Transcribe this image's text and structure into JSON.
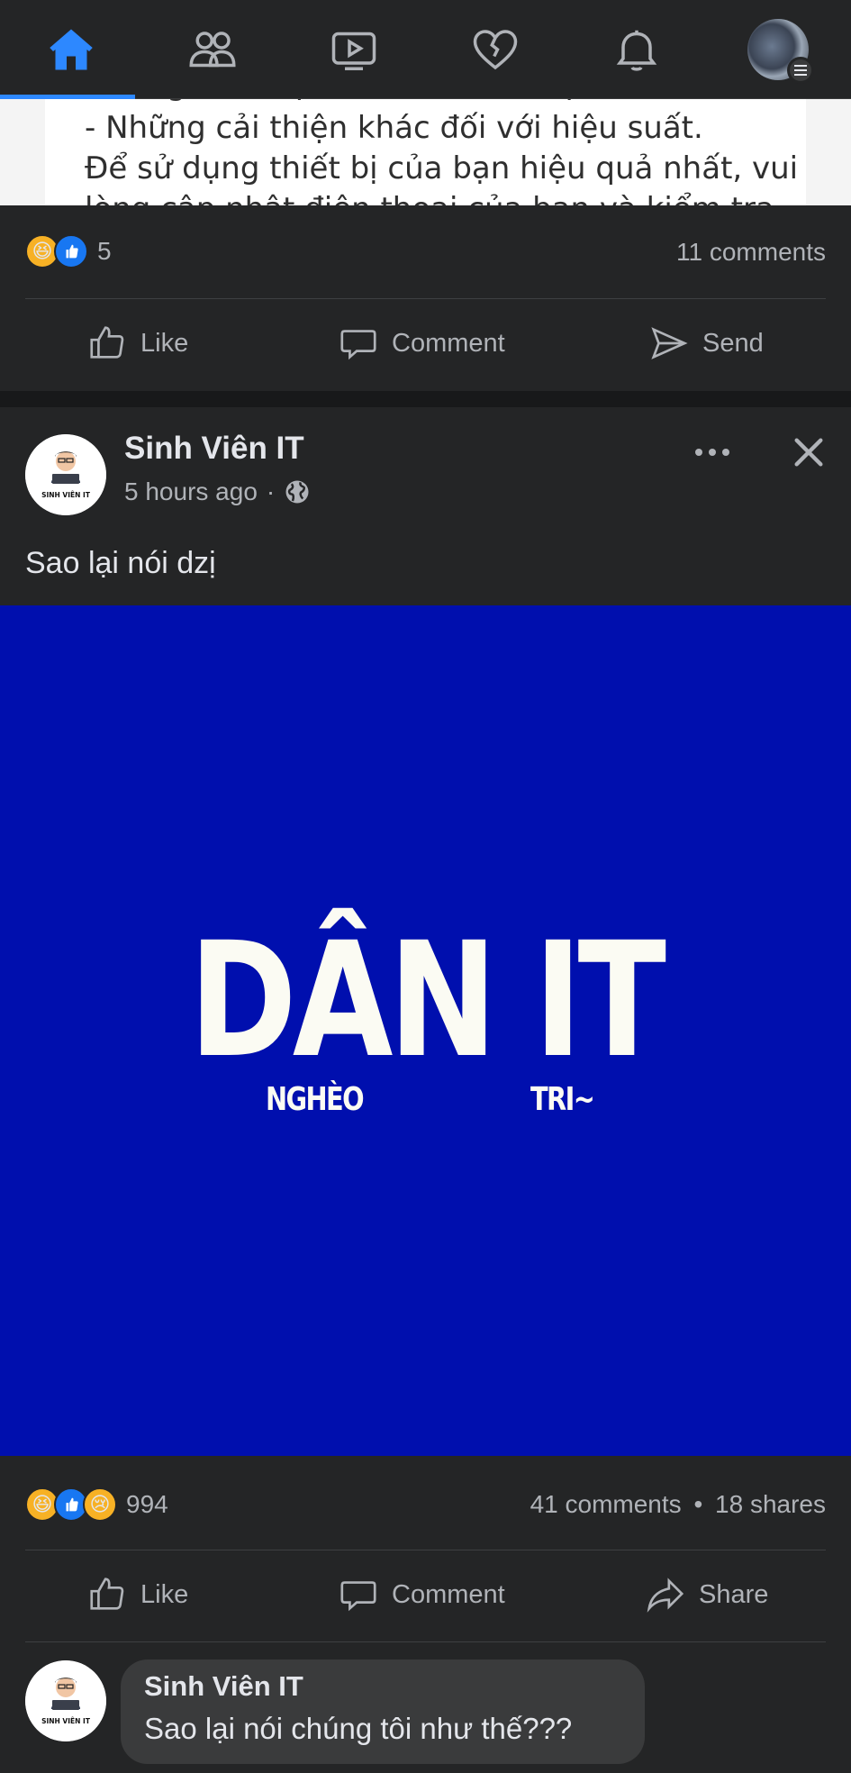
{
  "nav": {
    "items": [
      "home",
      "friends",
      "watch",
      "dating",
      "notifications",
      "profile-menu"
    ]
  },
  "prev_post": {
    "image_lines": [
      "- Những cải thiện khác đối với hiệu suất.",
      "Để sử dụng thiết bị của bạn hiệu quả nhất, vui",
      "lòng cập nhật điện thoại của bạn và kiểm tra"
    ],
    "reaction_count": "5",
    "comments": "11 comments",
    "actions": {
      "like": "Like",
      "comment": "Comment",
      "send": "Send"
    }
  },
  "post": {
    "page_name": "Sinh Viên IT",
    "time": "5 hours ago",
    "time_sep": "·",
    "text": "Sao lại nói dzị",
    "image": {
      "title": "DÂN IT",
      "left_sub": "NGHÈO",
      "right_sub": "TRI~"
    },
    "reaction_count": "994",
    "comments": "41 comments",
    "shares": "18 shares",
    "stats_sep": "•",
    "actions": {
      "like": "Like",
      "comment": "Comment",
      "share": "Share"
    }
  },
  "comment": {
    "author": "Sinh Viên IT",
    "text": "Sao lại nói chúng tôi như thế???"
  },
  "avatar_caption": "SINH VIÊN IT",
  "colors": {
    "background": "#18191a",
    "card": "#242526",
    "accent": "#2d88ff",
    "post_image_bg": "#000fae"
  }
}
